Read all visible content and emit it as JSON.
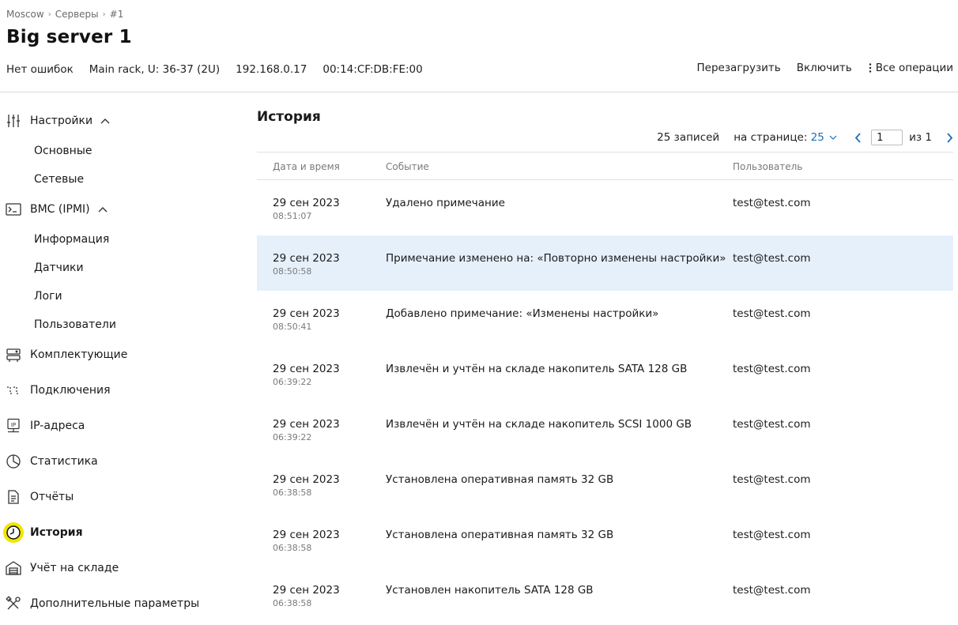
{
  "breadcrumb": [
    "Moscow",
    "Серверы",
    "#1"
  ],
  "title": "Big server 1",
  "meta": [
    "Нет ошибок",
    "Main rack, U: 36-37 (2U)",
    "192.168.0.17",
    "00:14:CF:DB:FE:00"
  ],
  "actions": {
    "reboot": "Перезагрузить",
    "power_on": "Включить",
    "all_ops": "Все операции"
  },
  "sidebar": {
    "settings": "Настройки",
    "settings_basic": "Основные",
    "settings_network": "Сетевые",
    "bmc": "BMC (IPMI)",
    "bmc_info": "Информация",
    "bmc_sensors": "Датчики",
    "bmc_logs": "Логи",
    "bmc_users": "Пользователи",
    "components": "Комплектующие",
    "connections": "Подключения",
    "ip": "IP-адреса",
    "stats": "Статистика",
    "reports": "Отчёты",
    "history": "История",
    "warehouse": "Учёт на складе",
    "extra": "Дополнительные параметры"
  },
  "main": {
    "heading": "История",
    "records": "25 записей",
    "per_page_label": "на странице:",
    "per_page_value": "25",
    "page": "1",
    "of": "из 1",
    "columns": {
      "datetime": "Дата и время",
      "event": "Событие",
      "user": "Пользователь"
    },
    "rows": [
      {
        "date": "29 сен 2023",
        "time": "08:51:07",
        "event": "Удалено примечание",
        "user": "test@test.com"
      },
      {
        "date": "29 сен 2023",
        "time": "08:50:58",
        "event": "Примечание изменено на: «Повторно изменены настройки»",
        "user": "test@test.com"
      },
      {
        "date": "29 сен 2023",
        "time": "08:50:41",
        "event": "Добавлено примечание: «Изменены настройки»",
        "user": "test@test.com"
      },
      {
        "date": "29 сен 2023",
        "time": "06:39:22",
        "event": "Извлечён и учтён на складе накопитель SATA 128 GB",
        "user": "test@test.com"
      },
      {
        "date": "29 сен 2023",
        "time": "06:39:22",
        "event": "Извлечён и учтён на складе накопитель SCSI 1000 GB",
        "user": "test@test.com"
      },
      {
        "date": "29 сен 2023",
        "time": "06:38:58",
        "event": "Установлена оперативная память 32 GB",
        "user": "test@test.com"
      },
      {
        "date": "29 сен 2023",
        "time": "06:38:58",
        "event": "Установлена оперативная память 32 GB",
        "user": "test@test.com"
      },
      {
        "date": "29 сен 2023",
        "time": "06:38:58",
        "event": "Установлен накопитель SATA 128 GB",
        "user": "test@test.com"
      }
    ]
  },
  "colors": {
    "accent": "#1c6fb8",
    "highlight_row": "#e6f0fb",
    "active_marker": "#f3e600"
  }
}
